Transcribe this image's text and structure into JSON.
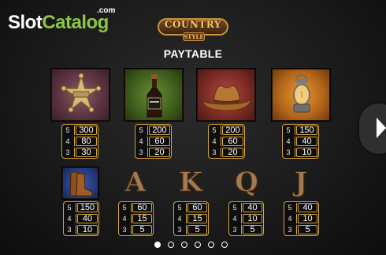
{
  "watermark": {
    "part1": "Slot",
    "part2": "Catalog",
    "suffix": ".com"
  },
  "game_logo": {
    "title": "COUNTRY",
    "subtitle": "STYLE"
  },
  "page_title": "PAYTABLE",
  "symbols": [
    {
      "icon": "sheriff-badge-icon",
      "pays": [
        {
          "count": "5",
          "value": "300"
        },
        {
          "count": "4",
          "value": "80"
        },
        {
          "count": "3",
          "value": "30"
        }
      ]
    },
    {
      "icon": "whiskey-bottle-icon",
      "pays": [
        {
          "count": "5",
          "value": "200"
        },
        {
          "count": "4",
          "value": "60"
        },
        {
          "count": "3",
          "value": "20"
        }
      ]
    },
    {
      "icon": "cowboy-hat-icon",
      "pays": [
        {
          "count": "5",
          "value": "200"
        },
        {
          "count": "4",
          "value": "60"
        },
        {
          "count": "3",
          "value": "20"
        }
      ]
    },
    {
      "icon": "oil-lantern-icon",
      "pays": [
        {
          "count": "5",
          "value": "150"
        },
        {
          "count": "4",
          "value": "40"
        },
        {
          "count": "3",
          "value": "10"
        }
      ]
    },
    {
      "icon": "cowboy-boots-icon",
      "pays": [
        {
          "count": "5",
          "value": "150"
        },
        {
          "count": "4",
          "value": "40"
        },
        {
          "count": "3",
          "value": "10"
        }
      ]
    },
    {
      "letter": "A",
      "pays": [
        {
          "count": "5",
          "value": "60"
        },
        {
          "count": "4",
          "value": "15"
        },
        {
          "count": "3",
          "value": "5"
        }
      ]
    },
    {
      "letter": "K",
      "pays": [
        {
          "count": "5",
          "value": "60"
        },
        {
          "count": "4",
          "value": "15"
        },
        {
          "count": "3",
          "value": "5"
        }
      ]
    },
    {
      "letter": "Q",
      "pays": [
        {
          "count": "5",
          "value": "40"
        },
        {
          "count": "4",
          "value": "10"
        },
        {
          "count": "3",
          "value": "5"
        }
      ]
    },
    {
      "letter": "J",
      "pays": [
        {
          "count": "5",
          "value": "40"
        },
        {
          "count": "4",
          "value": "10"
        },
        {
          "count": "3",
          "value": "5"
        }
      ]
    }
  ],
  "pagination": {
    "pages": 6,
    "current": 1
  },
  "next_button": {
    "icon": "chevron-right-icon"
  },
  "colors": {
    "accent_gold": "#d4a43c",
    "brand_green": "#8dc63f",
    "background": "#1a1a1a"
  }
}
